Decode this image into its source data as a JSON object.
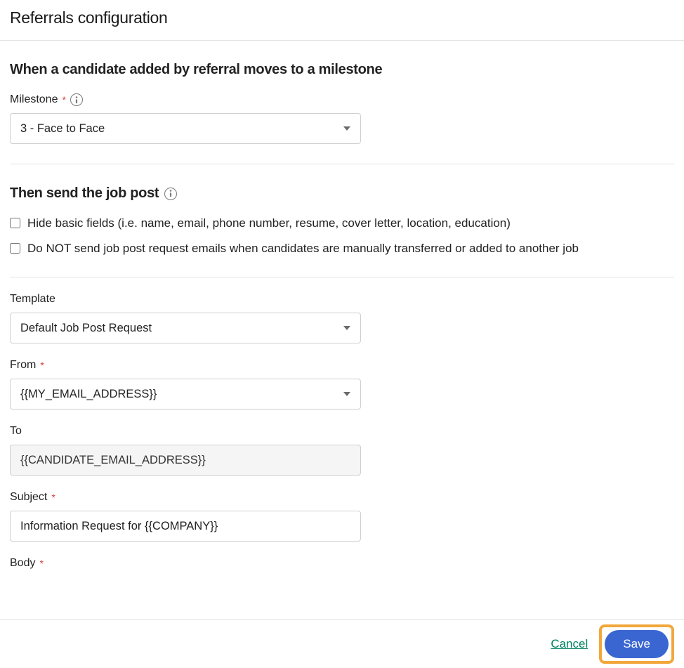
{
  "header": {
    "title": "Referrals configuration"
  },
  "section1": {
    "title": "When a candidate added by referral moves to a milestone",
    "milestone_label": "Milestone",
    "milestone_value": "3 - Face to Face"
  },
  "section2": {
    "title": "Then send the job post",
    "chk_hide_label": "Hide basic fields (i.e. name, email, phone number, resume, cover letter, location, education)",
    "chk_nosend_label": "Do NOT send job post request emails when candidates are manually transferred or added to another job"
  },
  "form": {
    "template_label": "Template",
    "template_value": "Default Job Post Request",
    "from_label": "From",
    "from_value": "{{MY_EMAIL_ADDRESS}}",
    "to_label": "To",
    "to_value": "{{CANDIDATE_EMAIL_ADDRESS}}",
    "subject_label": "Subject",
    "subject_value": "Information Request for {{COMPANY}}",
    "body_label": "Body"
  },
  "footer": {
    "cancel": "Cancel",
    "save": "Save"
  }
}
